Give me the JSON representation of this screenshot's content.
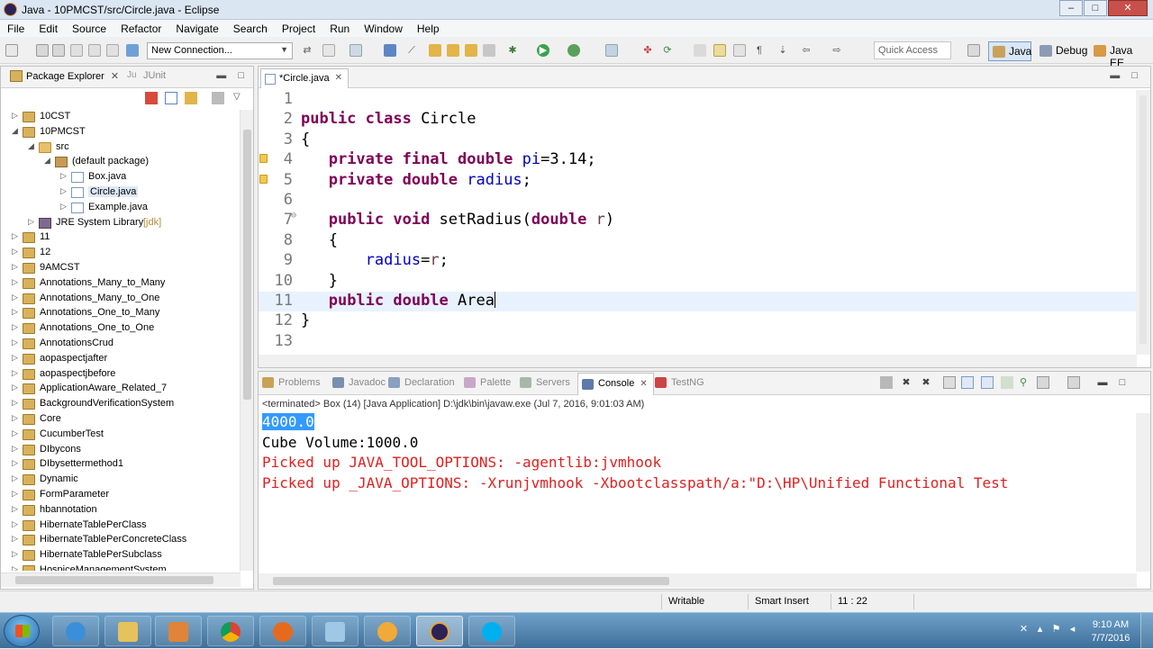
{
  "window": {
    "title": "Java - 10PMCST/src/Circle.java - Eclipse",
    "controls": [
      "–",
      "□",
      "✕"
    ]
  },
  "menu": [
    "File",
    "Edit",
    "Source",
    "Refactor",
    "Navigate",
    "Search",
    "Project",
    "Run",
    "Window",
    "Help"
  ],
  "toolbar": {
    "connection_value": "New Connection...",
    "quick_access_placeholder": "Quick Access",
    "perspectives": [
      "Java",
      "Debug",
      "Java EE"
    ]
  },
  "package_explorer": {
    "tab_label": "Package Explorer",
    "junit_label": "JUnit",
    "jre_decoration": "[jdk]",
    "tree": [
      {
        "label": "10CST",
        "level": 0,
        "twisty": "▷",
        "icon": "project"
      },
      {
        "label": "10PMCST",
        "level": 0,
        "twisty": "◢",
        "icon": "project"
      },
      {
        "label": "src",
        "level": 1,
        "twisty": "◢",
        "icon": "folder"
      },
      {
        "label": "(default package)",
        "level": 2,
        "twisty": "◢",
        "icon": "package"
      },
      {
        "label": "Box.java",
        "level": 3,
        "twisty": "▷",
        "icon": "java"
      },
      {
        "label": "Circle.java",
        "level": 3,
        "twisty": "▷",
        "icon": "java",
        "selected": true
      },
      {
        "label": "Example.java",
        "level": 3,
        "twisty": "▷",
        "icon": "java"
      },
      {
        "label": "JRE System Library",
        "level": 1,
        "twisty": "▷",
        "icon": "library",
        "decoration": true
      },
      {
        "label": "11",
        "level": 0,
        "twisty": "▷",
        "icon": "project"
      },
      {
        "label": "12",
        "level": 0,
        "twisty": "▷",
        "icon": "project"
      },
      {
        "label": "9AMCST",
        "level": 0,
        "twisty": "▷",
        "icon": "project"
      },
      {
        "label": "Annotations_Many_to_Many",
        "level": 0,
        "twisty": "▷",
        "icon": "project"
      },
      {
        "label": "Annotations_Many_to_One",
        "level": 0,
        "twisty": "▷",
        "icon": "project"
      },
      {
        "label": "Annotations_One_to_Many",
        "level": 0,
        "twisty": "▷",
        "icon": "project"
      },
      {
        "label": "Annotations_One_to_One",
        "level": 0,
        "twisty": "▷",
        "icon": "project"
      },
      {
        "label": "AnnotationsCrud",
        "level": 0,
        "twisty": "▷",
        "icon": "project"
      },
      {
        "label": "aopaspectjafter",
        "level": 0,
        "twisty": "▷",
        "icon": "project"
      },
      {
        "label": "aopaspectjbefore",
        "level": 0,
        "twisty": "▷",
        "icon": "project"
      },
      {
        "label": "ApplicationAware_Related_7",
        "level": 0,
        "twisty": "▷",
        "icon": "project"
      },
      {
        "label": "BackgroundVerificationSystem",
        "level": 0,
        "twisty": "▷",
        "icon": "project"
      },
      {
        "label": "Core",
        "level": 0,
        "twisty": "▷",
        "icon": "project"
      },
      {
        "label": "CucumberTest",
        "level": 0,
        "twisty": "▷",
        "icon": "project"
      },
      {
        "label": "DIbycons",
        "level": 0,
        "twisty": "▷",
        "icon": "project"
      },
      {
        "label": "DIbysettermethod1",
        "level": 0,
        "twisty": "▷",
        "icon": "project"
      },
      {
        "label": "Dynamic",
        "level": 0,
        "twisty": "▷",
        "icon": "project"
      },
      {
        "label": "FormParameter",
        "level": 0,
        "twisty": "▷",
        "icon": "project"
      },
      {
        "label": "hbannotation",
        "level": 0,
        "twisty": "▷",
        "icon": "project"
      },
      {
        "label": "HibernateTablePerClass",
        "level": 0,
        "twisty": "▷",
        "icon": "project"
      },
      {
        "label": "HibernateTablePerConcreteClass",
        "level": 0,
        "twisty": "▷",
        "icon": "project"
      },
      {
        "label": "HibernateTablePerSubclass",
        "level": 0,
        "twisty": "▷",
        "icon": "project"
      },
      {
        "label": "HospiceManagementSystem",
        "level": 0,
        "twisty": "▷",
        "icon": "project"
      }
    ]
  },
  "editor": {
    "tab_label": "*Circle.java",
    "lines": [
      {
        "n": "1",
        "tokens": []
      },
      {
        "n": "2",
        "tokens": [
          {
            "t": "public class ",
            "c": "kw"
          },
          {
            "t": "Circle",
            "c": ""
          }
        ]
      },
      {
        "n": "3",
        "tokens": [
          {
            "t": "{",
            "c": ""
          }
        ]
      },
      {
        "n": "4",
        "tokens": [
          {
            "t": "   ",
            "c": ""
          },
          {
            "t": "private final double ",
            "c": "kw"
          },
          {
            "t": "pi",
            "c": "fld"
          },
          {
            "t": "=3.14;",
            "c": ""
          }
        ],
        "warn": true
      },
      {
        "n": "5",
        "tokens": [
          {
            "t": "   ",
            "c": ""
          },
          {
            "t": "private double ",
            "c": "kw"
          },
          {
            "t": "radius",
            "c": "fld"
          },
          {
            "t": ";",
            "c": ""
          }
        ],
        "warn": true
      },
      {
        "n": "6",
        "tokens": []
      },
      {
        "n": "7",
        "fold": "⊖",
        "tokens": [
          {
            "t": "   ",
            "c": ""
          },
          {
            "t": "public void ",
            "c": "kw"
          },
          {
            "t": "setRadius(",
            "c": ""
          },
          {
            "t": "double ",
            "c": "kw"
          },
          {
            "t": "r",
            "c": "prm"
          },
          {
            "t": ")",
            "c": ""
          }
        ]
      },
      {
        "n": "8",
        "tokens": [
          {
            "t": "   {",
            "c": ""
          }
        ]
      },
      {
        "n": "9",
        "tokens": [
          {
            "t": "       ",
            "c": ""
          },
          {
            "t": "radius",
            "c": "fld"
          },
          {
            "t": "=",
            "c": ""
          },
          {
            "t": "r",
            "c": "prm"
          },
          {
            "t": ";",
            "c": ""
          }
        ]
      },
      {
        "n": "10",
        "tokens": [
          {
            "t": "   }",
            "c": ""
          }
        ]
      },
      {
        "n": "11",
        "current": true,
        "caret": true,
        "tokens": [
          {
            "t": "   ",
            "c": ""
          },
          {
            "t": "public double ",
            "c": "kw"
          },
          {
            "t": "Area",
            "c": ""
          }
        ]
      },
      {
        "n": "12",
        "tokens": [
          {
            "t": "}",
            "c": ""
          }
        ]
      },
      {
        "n": "13",
        "tokens": []
      }
    ]
  },
  "console": {
    "tabs": [
      "Problems",
      "Javadoc",
      "Declaration",
      "Palette",
      "Servers",
      "Console",
      "TestNG"
    ],
    "active_tab": "Console",
    "status": "<terminated> Box (14) [Java Application] D:\\jdk\\bin\\javaw.exe (Jul 7, 2016, 9:01:03 AM)",
    "output": [
      {
        "text": "4000.0",
        "type": "normal",
        "highlight": true
      },
      {
        "text": "Cube Volume:1000.0",
        "type": "normal"
      },
      {
        "text": "Picked up JAVA_TOOL_OPTIONS: -agentlib:jvmhook",
        "type": "err"
      },
      {
        "text": "Picked up _JAVA_OPTIONS: -Xrunjvmhook -Xbootclasspath/a:\"D:\\HP\\Unified Functional Test",
        "type": "err"
      }
    ]
  },
  "statusbar": {
    "writable": "Writable",
    "insert_mode": "Smart Insert",
    "position": "11 : 22"
  },
  "taskbar": {
    "time": "9:10 AM",
    "date": "7/7/2016"
  },
  "colors": {
    "keyword": "#7f0055",
    "field": "#0000c0",
    "parameter": "#6a3e3e",
    "error_output": "#e02020",
    "selection": "#3399ff",
    "current_line": "#e8f2fe"
  }
}
